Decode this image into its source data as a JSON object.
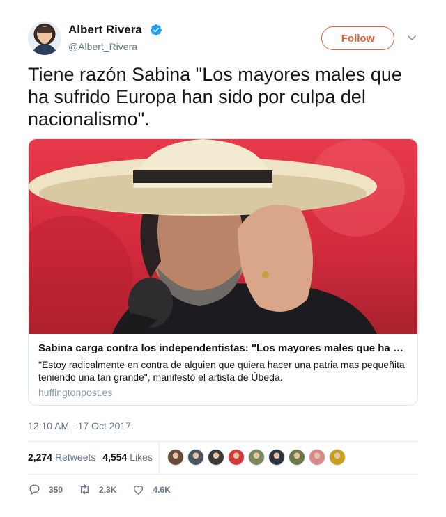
{
  "author": {
    "name": "Albert Rivera",
    "handle": "@Albert_Rivera",
    "verified": true
  },
  "header": {
    "follow_label": "Follow",
    "accent_color": "#e0603a"
  },
  "tweet": {
    "text": "Tiene razón Sabina \"Los mayores males que ha sufrido Europa han sido por culpa del nacionalismo\".",
    "timestamp": "12:10 AM - 17 Oct 2017"
  },
  "card": {
    "title": "Sabina carga contra los independentistas: \"Los mayores males que ha sufrido Europa han sido por culpa del nacionalismo\"",
    "description": "\"Estoy radicalmente en contra de alguien que quiera hacer una patria mas pequeñita teniendo una tan grande\", manifestó el artista de Úbeda.",
    "domain": "huffingtonpost.es"
  },
  "stats": {
    "retweets_count": "2,274",
    "retweets_label": "Retweets",
    "likes_count": "4,554",
    "likes_label": "Likes",
    "liker_colors": [
      "#6b4a3a",
      "#4a5563",
      "#3a3a3a",
      "#d23a3a",
      "#7a8a5a",
      "#2f3540",
      "#6a7a4a",
      "#d88a8a",
      "#c8a020"
    ]
  },
  "actions": {
    "reply_count": "350",
    "retweet_count": "2.3K",
    "like_count": "4.6K"
  }
}
